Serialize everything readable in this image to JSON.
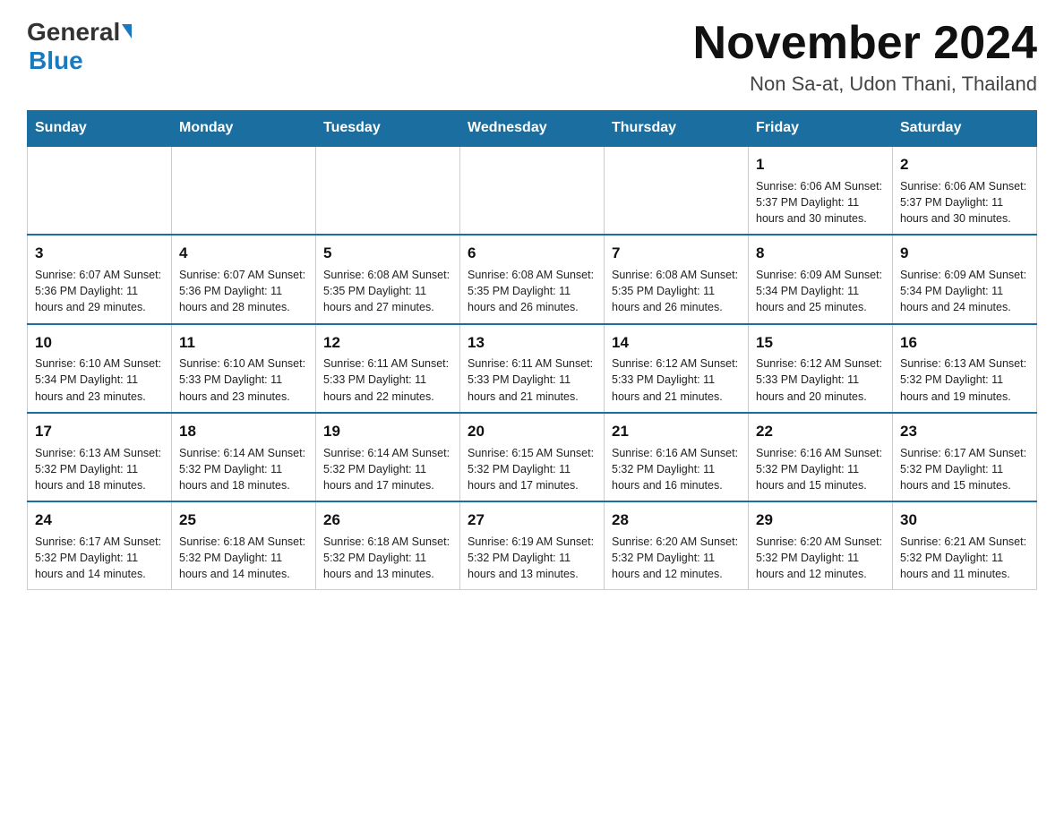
{
  "header": {
    "logo_general": "General",
    "logo_blue": "Blue",
    "month_title": "November 2024",
    "location": "Non Sa-at, Udon Thani, Thailand"
  },
  "calendar": {
    "days_of_week": [
      "Sunday",
      "Monday",
      "Tuesday",
      "Wednesday",
      "Thursday",
      "Friday",
      "Saturday"
    ],
    "weeks": [
      [
        {
          "day": "",
          "info": ""
        },
        {
          "day": "",
          "info": ""
        },
        {
          "day": "",
          "info": ""
        },
        {
          "day": "",
          "info": ""
        },
        {
          "day": "",
          "info": ""
        },
        {
          "day": "1",
          "info": "Sunrise: 6:06 AM\nSunset: 5:37 PM\nDaylight: 11 hours and 30 minutes."
        },
        {
          "day": "2",
          "info": "Sunrise: 6:06 AM\nSunset: 5:37 PM\nDaylight: 11 hours and 30 minutes."
        }
      ],
      [
        {
          "day": "3",
          "info": "Sunrise: 6:07 AM\nSunset: 5:36 PM\nDaylight: 11 hours and 29 minutes."
        },
        {
          "day": "4",
          "info": "Sunrise: 6:07 AM\nSunset: 5:36 PM\nDaylight: 11 hours and 28 minutes."
        },
        {
          "day": "5",
          "info": "Sunrise: 6:08 AM\nSunset: 5:35 PM\nDaylight: 11 hours and 27 minutes."
        },
        {
          "day": "6",
          "info": "Sunrise: 6:08 AM\nSunset: 5:35 PM\nDaylight: 11 hours and 26 minutes."
        },
        {
          "day": "7",
          "info": "Sunrise: 6:08 AM\nSunset: 5:35 PM\nDaylight: 11 hours and 26 minutes."
        },
        {
          "day": "8",
          "info": "Sunrise: 6:09 AM\nSunset: 5:34 PM\nDaylight: 11 hours and 25 minutes."
        },
        {
          "day": "9",
          "info": "Sunrise: 6:09 AM\nSunset: 5:34 PM\nDaylight: 11 hours and 24 minutes."
        }
      ],
      [
        {
          "day": "10",
          "info": "Sunrise: 6:10 AM\nSunset: 5:34 PM\nDaylight: 11 hours and 23 minutes."
        },
        {
          "day": "11",
          "info": "Sunrise: 6:10 AM\nSunset: 5:33 PM\nDaylight: 11 hours and 23 minutes."
        },
        {
          "day": "12",
          "info": "Sunrise: 6:11 AM\nSunset: 5:33 PM\nDaylight: 11 hours and 22 minutes."
        },
        {
          "day": "13",
          "info": "Sunrise: 6:11 AM\nSunset: 5:33 PM\nDaylight: 11 hours and 21 minutes."
        },
        {
          "day": "14",
          "info": "Sunrise: 6:12 AM\nSunset: 5:33 PM\nDaylight: 11 hours and 21 minutes."
        },
        {
          "day": "15",
          "info": "Sunrise: 6:12 AM\nSunset: 5:33 PM\nDaylight: 11 hours and 20 minutes."
        },
        {
          "day": "16",
          "info": "Sunrise: 6:13 AM\nSunset: 5:32 PM\nDaylight: 11 hours and 19 minutes."
        }
      ],
      [
        {
          "day": "17",
          "info": "Sunrise: 6:13 AM\nSunset: 5:32 PM\nDaylight: 11 hours and 18 minutes."
        },
        {
          "day": "18",
          "info": "Sunrise: 6:14 AM\nSunset: 5:32 PM\nDaylight: 11 hours and 18 minutes."
        },
        {
          "day": "19",
          "info": "Sunrise: 6:14 AM\nSunset: 5:32 PM\nDaylight: 11 hours and 17 minutes."
        },
        {
          "day": "20",
          "info": "Sunrise: 6:15 AM\nSunset: 5:32 PM\nDaylight: 11 hours and 17 minutes."
        },
        {
          "day": "21",
          "info": "Sunrise: 6:16 AM\nSunset: 5:32 PM\nDaylight: 11 hours and 16 minutes."
        },
        {
          "day": "22",
          "info": "Sunrise: 6:16 AM\nSunset: 5:32 PM\nDaylight: 11 hours and 15 minutes."
        },
        {
          "day": "23",
          "info": "Sunrise: 6:17 AM\nSunset: 5:32 PM\nDaylight: 11 hours and 15 minutes."
        }
      ],
      [
        {
          "day": "24",
          "info": "Sunrise: 6:17 AM\nSunset: 5:32 PM\nDaylight: 11 hours and 14 minutes."
        },
        {
          "day": "25",
          "info": "Sunrise: 6:18 AM\nSunset: 5:32 PM\nDaylight: 11 hours and 14 minutes."
        },
        {
          "day": "26",
          "info": "Sunrise: 6:18 AM\nSunset: 5:32 PM\nDaylight: 11 hours and 13 minutes."
        },
        {
          "day": "27",
          "info": "Sunrise: 6:19 AM\nSunset: 5:32 PM\nDaylight: 11 hours and 13 minutes."
        },
        {
          "day": "28",
          "info": "Sunrise: 6:20 AM\nSunset: 5:32 PM\nDaylight: 11 hours and 12 minutes."
        },
        {
          "day": "29",
          "info": "Sunrise: 6:20 AM\nSunset: 5:32 PM\nDaylight: 11 hours and 12 minutes."
        },
        {
          "day": "30",
          "info": "Sunrise: 6:21 AM\nSunset: 5:32 PM\nDaylight: 11 hours and 11 minutes."
        }
      ]
    ]
  }
}
